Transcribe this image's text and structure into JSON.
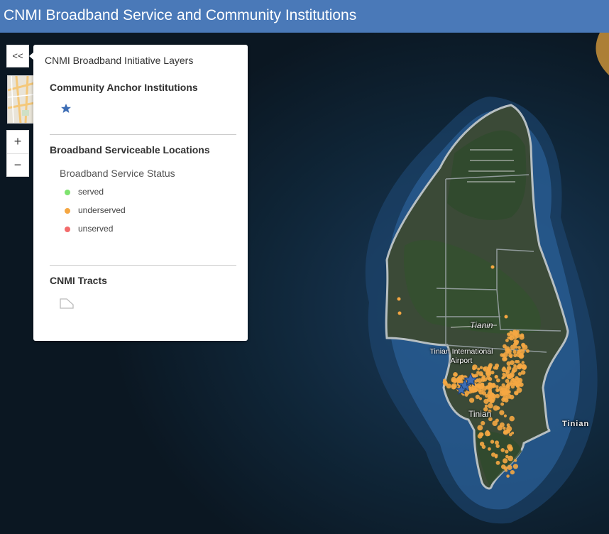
{
  "header": {
    "title": "CNMI Broadband Service and Community Institutions"
  },
  "map": {
    "labels": {
      "area": "Tianin",
      "airport_line1": "Tinian International",
      "airport_line2": "Airport",
      "town": "Tinian",
      "island": "Tinian"
    }
  },
  "controls": {
    "collapse_label": "<<",
    "zoom_in_label": "+",
    "zoom_out_label": "−"
  },
  "legend": {
    "title": "CNMI Broadband Initiative Layers",
    "layers": [
      {
        "title": "Community Anchor Institutions",
        "icon": "star-icon"
      },
      {
        "title": "Broadband Serviceable Locations",
        "field": "Broadband Service Status",
        "classes": [
          {
            "label": "served",
            "color": "#7ee36f"
          },
          {
            "label": "underserved",
            "color": "#f5a742"
          },
          {
            "label": "unserved",
            "color": "#f36b6b"
          }
        ]
      },
      {
        "title": "CNMI Tracts",
        "icon": "polygon-outline-icon"
      }
    ]
  },
  "colors": {
    "header_bg": "#4a79b8",
    "star": "#3d6db5",
    "point_underserved": "#f5a742"
  }
}
